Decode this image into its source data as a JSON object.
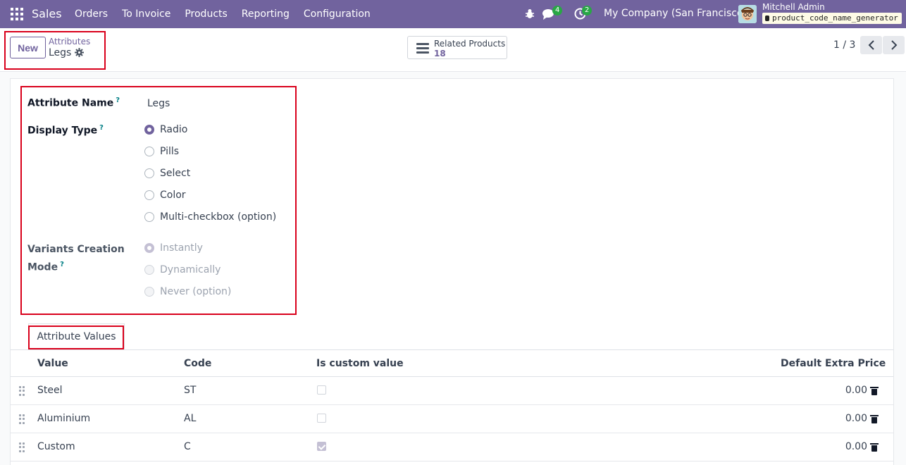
{
  "navbar": {
    "app_name": "Sales",
    "menu": [
      "Orders",
      "To Invoice",
      "Products",
      "Reporting",
      "Configuration"
    ],
    "messages_count": "4",
    "activities_count": "2",
    "company": "My Company (San Francisco)",
    "user_name": "Mitchell Admin",
    "database": "product_code_name_generator"
  },
  "control": {
    "new_label": "New",
    "breadcrumb_parent": "Attributes",
    "breadcrumb_current": "Legs",
    "smart_button_label": "Related Products",
    "smart_button_count": "18",
    "pager": "1 / 3"
  },
  "form": {
    "attribute_name_label": "Attribute Name",
    "attribute_name_value": "Legs",
    "help_mark": "?",
    "display_type_label": "Display Type",
    "display_type_options": [
      "Radio",
      "Pills",
      "Select",
      "Color",
      "Multi-checkbox (option)"
    ],
    "display_type_selected": "Radio",
    "variants_label_line1": "Variants Creation",
    "variants_label_line2": "Mode",
    "variants_options": [
      "Instantly",
      "Dynamically",
      "Never (option)"
    ],
    "variants_selected": "Instantly"
  },
  "tabs": {
    "attribute_values": "Attribute Values"
  },
  "table": {
    "headers": [
      "Value",
      "Code",
      "Is custom value",
      "Default Extra Price"
    ],
    "rows": [
      {
        "value": "Steel",
        "code": "ST",
        "is_custom": false,
        "price": "0.00"
      },
      {
        "value": "Aluminium",
        "code": "AL",
        "is_custom": false,
        "price": "0.00"
      },
      {
        "value": "Custom",
        "code": "C",
        "is_custom": true,
        "price": "0.00"
      }
    ]
  },
  "colors": {
    "navbar": "#71639e",
    "accent": "#71639e",
    "highlight": "#d9001b"
  }
}
